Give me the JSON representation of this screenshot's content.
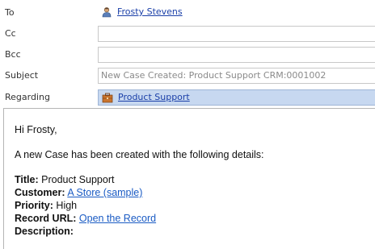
{
  "fields": {
    "to_label": "To",
    "to_value": "Frosty Stevens",
    "cc_label": "Cc",
    "bcc_label": "Bcc",
    "subject_label": "Subject",
    "subject_value": "New Case Created: Product Support CRM:0001002",
    "regarding_label": "Regarding",
    "regarding_value": "Product Support"
  },
  "icons": {
    "to": "contact-person-icon",
    "regarding": "case-icon"
  },
  "body": {
    "greeting": "Hi Frosty,",
    "intro": "A new Case has been created with the following details:",
    "title_label": "Title:",
    "title_value": "Product Support",
    "customer_label": "Customer:",
    "customer_value": "A Store (sample)",
    "priority_label": "Priority:",
    "priority_value": "High",
    "record_url_label": "Record URL:",
    "record_url_value": "Open the Record",
    "description_label": "Description:"
  },
  "colors": {
    "link": "#1a5bc4",
    "regarding_highlight": "#c7d8f0"
  }
}
